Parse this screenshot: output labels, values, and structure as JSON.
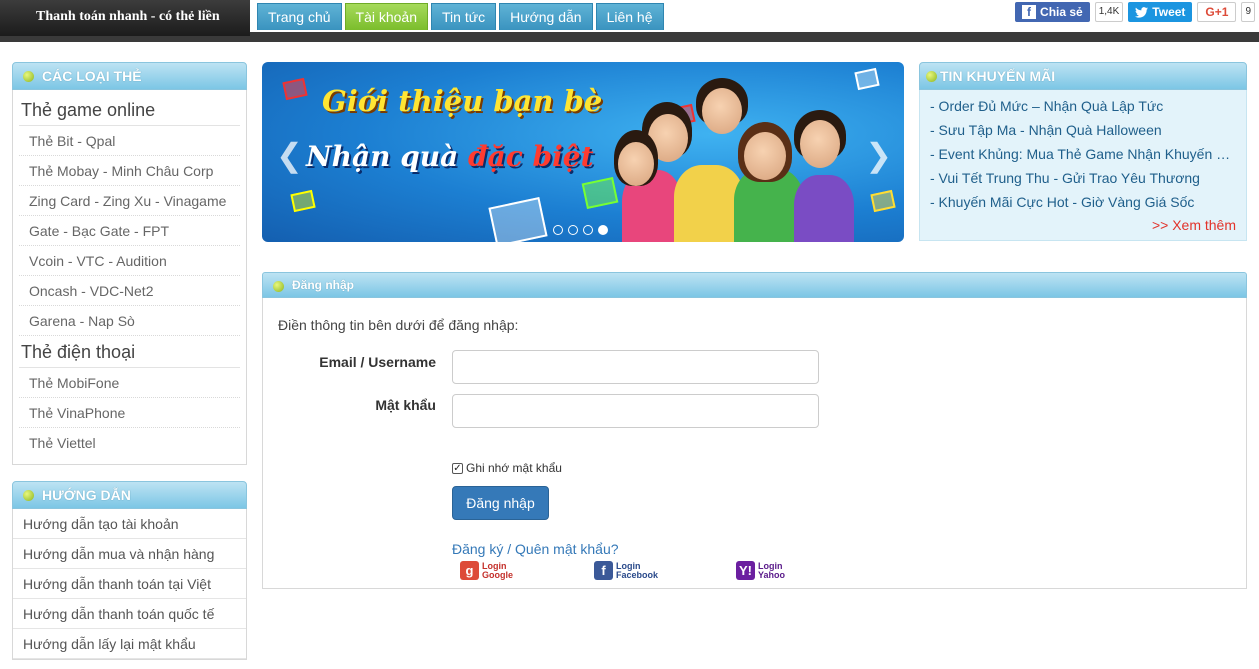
{
  "site": {
    "slogan": "Thanh toán nhanh - có thẻ liền"
  },
  "nav": [
    {
      "label": "Trang chủ"
    },
    {
      "label": "Tài khoản",
      "active": true
    },
    {
      "label": "Tin tức"
    },
    {
      "label": "Hướng dẫn"
    },
    {
      "label": "Liên hệ"
    }
  ],
  "social": {
    "share_label": "Chia sẻ",
    "share_count": "1,4K",
    "tweet_label": "Tweet",
    "gplus_label": "G+1",
    "gplus_count": "9"
  },
  "cards": {
    "title": "CÁC LOẠI THẺ",
    "game_title": "Thẻ game online",
    "game_items": [
      "Thẻ Bit - Qpal",
      "Thẻ Mobay - Minh Châu Corp",
      "Zing Card - Zing Xu - Vinagame",
      "Gate - Bạc Gate - FPT",
      "Vcoin - VTC - Audition",
      "Oncash - VDC-Net2",
      "Garena - Nap Sò"
    ],
    "phone_title": "Thẻ điện thoại",
    "phone_items": [
      "Thẻ MobiFone",
      "Thẻ VinaPhone",
      "Thẻ Viettel"
    ]
  },
  "guide": {
    "title": "HƯỚNG DẪN",
    "items": [
      "Hướng dẫn tạo tài khoản",
      "Hướng dẫn mua và nhận hàng",
      "Hướng dẫn thanh toán tại Việt",
      "Hướng dẫn thanh toán quốc tế",
      "Hướng dẫn lấy lại mật khẩu"
    ]
  },
  "banner": {
    "line1": "Giới thiệu bạn bè",
    "line2a": "Nhận quà ",
    "line2b": "đặc biệt",
    "slides_total": 4,
    "slide_active": 4
  },
  "promo": {
    "title": "TIN KHUYẾN MÃI",
    "items": [
      "- Order Đủ Mức – Nhận Quà Lập Tức",
      "- Sưu Tập Ma - Nhận Quà Halloween",
      "- Event Khủng: Mua Thẻ Game Nhận Khuyến Mãi",
      "- Vui Tết Trung Thu - Gửi Trao Yêu Thương",
      "- Khuyến Mãi Cực Hot - Giờ Vàng Giá Sốc"
    ],
    "more": ">> Xem thêm"
  },
  "login": {
    "title": "Đăng nhập",
    "intro": "Điền thông tin bên dưới để đăng nhập:",
    "email_label": "Email / Username",
    "email_value": "",
    "password_label": "Mật khẩu",
    "password_value": "",
    "remember_label": "Ghi nhớ mật khẩu",
    "remember_checked": true,
    "submit": "Đăng nhập",
    "links": "Đăng ký / Quên mật khẩu?",
    "google": {
      "l1": "Login",
      "l2": "Google"
    },
    "facebook": {
      "l1": "Login",
      "l2": "Facebook"
    },
    "yahoo": {
      "l1": "Login",
      "l2": "Yahoo"
    }
  },
  "colors": {
    "nav_tab": "#3a93bf",
    "nav_active": "#7bbd2c",
    "header_gradient": "#7cc6e5",
    "link": "#3579b8",
    "more_link": "#e2332b"
  }
}
